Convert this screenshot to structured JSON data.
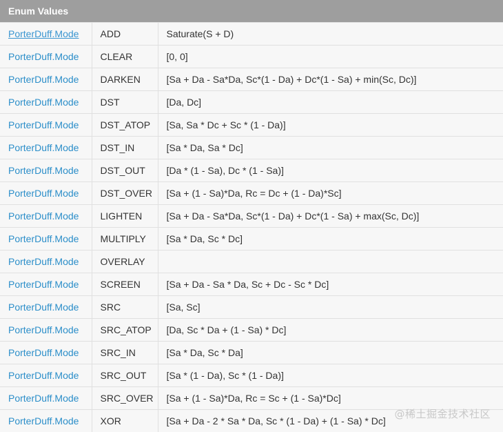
{
  "header": {
    "title": "Enum Values"
  },
  "rows": [
    {
      "type": "PorterDuff.Mode",
      "name": "ADD",
      "formula": "Saturate(S + D)"
    },
    {
      "type": "PorterDuff.Mode",
      "name": "CLEAR",
      "formula": "[0, 0]"
    },
    {
      "type": "PorterDuff.Mode",
      "name": "DARKEN",
      "formula": "[Sa + Da - Sa*Da, Sc*(1 - Da) + Dc*(1 - Sa) + min(Sc, Dc)]"
    },
    {
      "type": "PorterDuff.Mode",
      "name": "DST",
      "formula": "[Da, Dc]"
    },
    {
      "type": "PorterDuff.Mode",
      "name": "DST_ATOP",
      "formula": "[Sa, Sa * Dc + Sc * (1 - Da)]"
    },
    {
      "type": "PorterDuff.Mode",
      "name": "DST_IN",
      "formula": "[Sa * Da, Sa * Dc]"
    },
    {
      "type": "PorterDuff.Mode",
      "name": "DST_OUT",
      "formula": "[Da * (1 - Sa), Dc * (1 - Sa)]"
    },
    {
      "type": "PorterDuff.Mode",
      "name": "DST_OVER",
      "formula": "[Sa + (1 - Sa)*Da, Rc = Dc + (1 - Da)*Sc]"
    },
    {
      "type": "PorterDuff.Mode",
      "name": "LIGHTEN",
      "formula": "[Sa + Da - Sa*Da, Sc*(1 - Da) + Dc*(1 - Sa) + max(Sc, Dc)]"
    },
    {
      "type": "PorterDuff.Mode",
      "name": "MULTIPLY",
      "formula": "[Sa * Da, Sc * Dc]"
    },
    {
      "type": "PorterDuff.Mode",
      "name": "OVERLAY",
      "formula": ""
    },
    {
      "type": "PorterDuff.Mode",
      "name": "SCREEN",
      "formula": "[Sa + Da - Sa * Da, Sc + Dc - Sc * Dc]"
    },
    {
      "type": "PorterDuff.Mode",
      "name": "SRC",
      "formula": "[Sa, Sc]"
    },
    {
      "type": "PorterDuff.Mode",
      "name": "SRC_ATOP",
      "formula": "[Da, Sc * Da + (1 - Sa) * Dc]"
    },
    {
      "type": "PorterDuff.Mode",
      "name": "SRC_IN",
      "formula": "[Sa * Da, Sc * Da]"
    },
    {
      "type": "PorterDuff.Mode",
      "name": "SRC_OUT",
      "formula": "[Sa * (1 - Da), Sc * (1 - Da)]"
    },
    {
      "type": "PorterDuff.Mode",
      "name": "SRC_OVER",
      "formula": "[Sa + (1 - Sa)*Da, Rc = Sc + (1 - Sa)*Dc]"
    },
    {
      "type": "PorterDuff.Mode",
      "name": "XOR",
      "formula": "[Sa + Da - 2 * Sa * Da, Sc * (1 - Da) + (1 - Sa) * Dc]"
    }
  ],
  "watermark": "@稀土掘金技术社区",
  "colors": {
    "header_bg": "#9e9e9e",
    "link": "#2b8ec9",
    "border": "#e0e0e0"
  }
}
